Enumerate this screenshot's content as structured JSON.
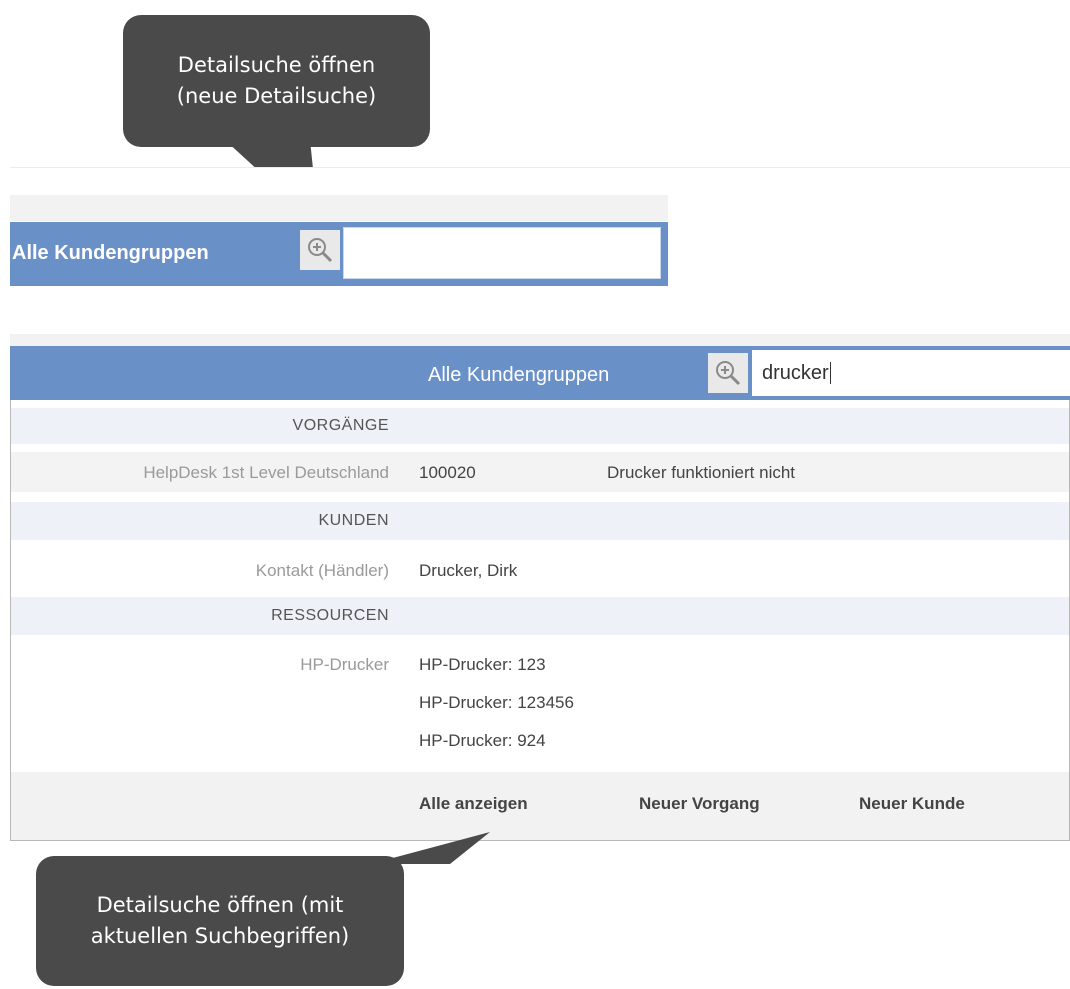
{
  "callout_top": {
    "text": "Detailsuche öffnen\n(neue Detailsuche)"
  },
  "search_bar_top": {
    "scope_label": "Alle Kundengruppen",
    "query": ""
  },
  "search_bar_active": {
    "scope_label": "Alle Kundengruppen",
    "query": "drucker"
  },
  "results": {
    "sections": [
      {
        "title": "VORGÄNGE",
        "rows": [
          {
            "category": "HelpDesk 1st Level Deutschland",
            "id": "100020",
            "summary": "Drucker funktioniert nicht"
          }
        ]
      },
      {
        "title": "KUNDEN",
        "rows": [
          {
            "category": "Kontakt (Händler)",
            "name": "Drucker, Dirk"
          }
        ]
      },
      {
        "title": "RESSOURCEN",
        "rows": [
          {
            "category": "HP-Drucker",
            "items": [
              "HP-Drucker: 123",
              "HP-Drucker: 123456",
              "HP-Drucker: 924"
            ]
          }
        ]
      }
    ],
    "footer": {
      "show_all": "Alle anzeigen",
      "new_case": "Neuer Vorgang",
      "new_customer": "Neuer Kunde"
    }
  },
  "callout_bottom": {
    "text": "Detailsuche öffnen (mit\naktuellen Suchbegriffen)"
  },
  "colors": {
    "bar": "#6a90c8",
    "section": "#eef1f7",
    "callout": "#4a4a4a"
  },
  "icons": {
    "search": "zoom-in-magnifier-icon"
  }
}
